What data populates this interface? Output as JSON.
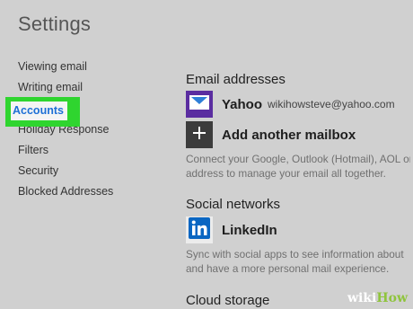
{
  "page": {
    "title": "Settings"
  },
  "sidebar": {
    "items": [
      {
        "label": "Viewing email"
      },
      {
        "label": "Writing email"
      },
      {
        "label": "Accounts",
        "active": true
      },
      {
        "label": "Holiday Response"
      },
      {
        "label": "Filters"
      },
      {
        "label": "Security"
      },
      {
        "label": "Blocked Addresses"
      }
    ]
  },
  "email_addresses": {
    "heading": "Email addresses",
    "yahoo": {
      "name": "Yahoo",
      "address": "wikihowsteve@yahoo.com",
      "icon": "envelope-icon"
    },
    "add": {
      "label": "Add another mailbox",
      "icon": "plus-icon"
    },
    "description_lines": [
      "Connect your Google, Outlook (Hotmail), AOL or",
      "address to manage your email all together."
    ]
  },
  "social_networks": {
    "heading": "Social networks",
    "linkedin": {
      "label": "LinkedIn",
      "icon": "linkedin-icon"
    },
    "description_lines": [
      "Sync with social apps to see information about",
      "and have a more personal mail experience."
    ]
  },
  "cloud_storage": {
    "heading": "Cloud storage"
  },
  "watermark": {
    "wiki": "wiki",
    "how": "How"
  },
  "colors": {
    "highlight": "#2fd52f",
    "active_link": "#1d6fd6",
    "yahoo_tile": "#5a2da0",
    "linkedin_blue": "#0a66c2",
    "background": "#d0d0d0"
  }
}
